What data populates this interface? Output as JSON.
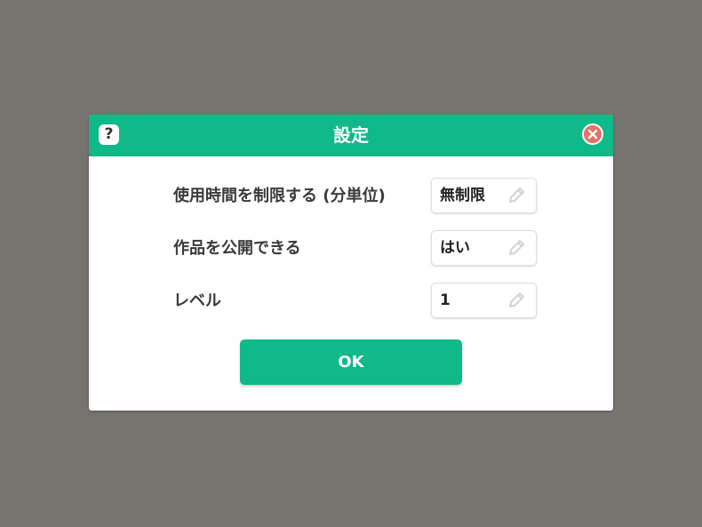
{
  "dialog": {
    "title": "設定",
    "help_label": "?",
    "close_icon": "close-icon",
    "ok_label": "OK"
  },
  "rows": [
    {
      "label": "使用時間を制限する (分単位)",
      "value": "無制限",
      "icon": "pencil-icon"
    },
    {
      "label": "作品を公開できる",
      "value": "はい",
      "icon": "pencil-icon"
    },
    {
      "label": "レベル",
      "value": "1",
      "icon": "pencil-icon"
    }
  ],
  "colors": {
    "background": "#77746f",
    "accent": "#0fb98a",
    "close": "#e77164",
    "text": "#3a3a3a"
  }
}
